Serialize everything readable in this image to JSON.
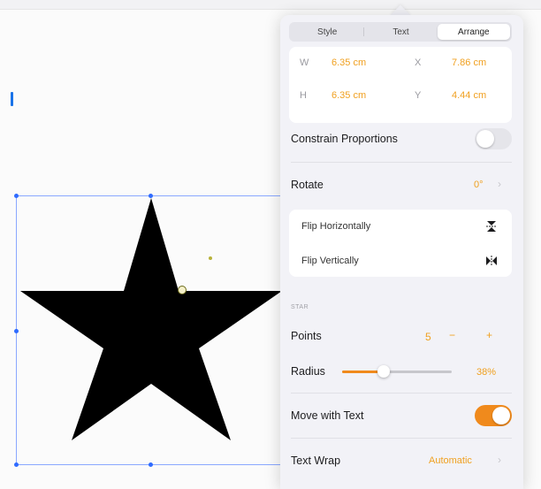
{
  "tabs": {
    "style": "Style",
    "text": "Text",
    "arrange": "Arrange",
    "active": "arrange"
  },
  "dimensions": {
    "w_label": "W",
    "w_value": "6.35 cm",
    "x_label": "X",
    "x_value": "7.86 cm",
    "h_label": "H",
    "h_value": "6.35 cm",
    "y_label": "Y",
    "y_value": "4.44 cm"
  },
  "constrain": {
    "label": "Constrain Proportions",
    "on": false
  },
  "rotate": {
    "label": "Rotate",
    "value": "0°"
  },
  "flip": {
    "horizontal": "Flip Horizontally",
    "vertical": "Flip Vertically"
  },
  "star": {
    "section": "STAR",
    "points_label": "Points",
    "points_value": "5",
    "minus": "−",
    "plus": "+",
    "radius_label": "Radius",
    "radius_value": "38%",
    "radius_fraction": 0.38
  },
  "move_with_text": {
    "label": "Move with Text",
    "on": true
  },
  "text_wrap": {
    "label": "Text Wrap",
    "value": "Automatic"
  },
  "colors": {
    "accent": "#f08a1c",
    "value_text": "#f0a020",
    "selection": "#2f6bff"
  },
  "icons": {
    "flip_h": "flip-horizontal-icon",
    "flip_v": "flip-vertical-icon",
    "chevron": "chevron-right-icon"
  }
}
